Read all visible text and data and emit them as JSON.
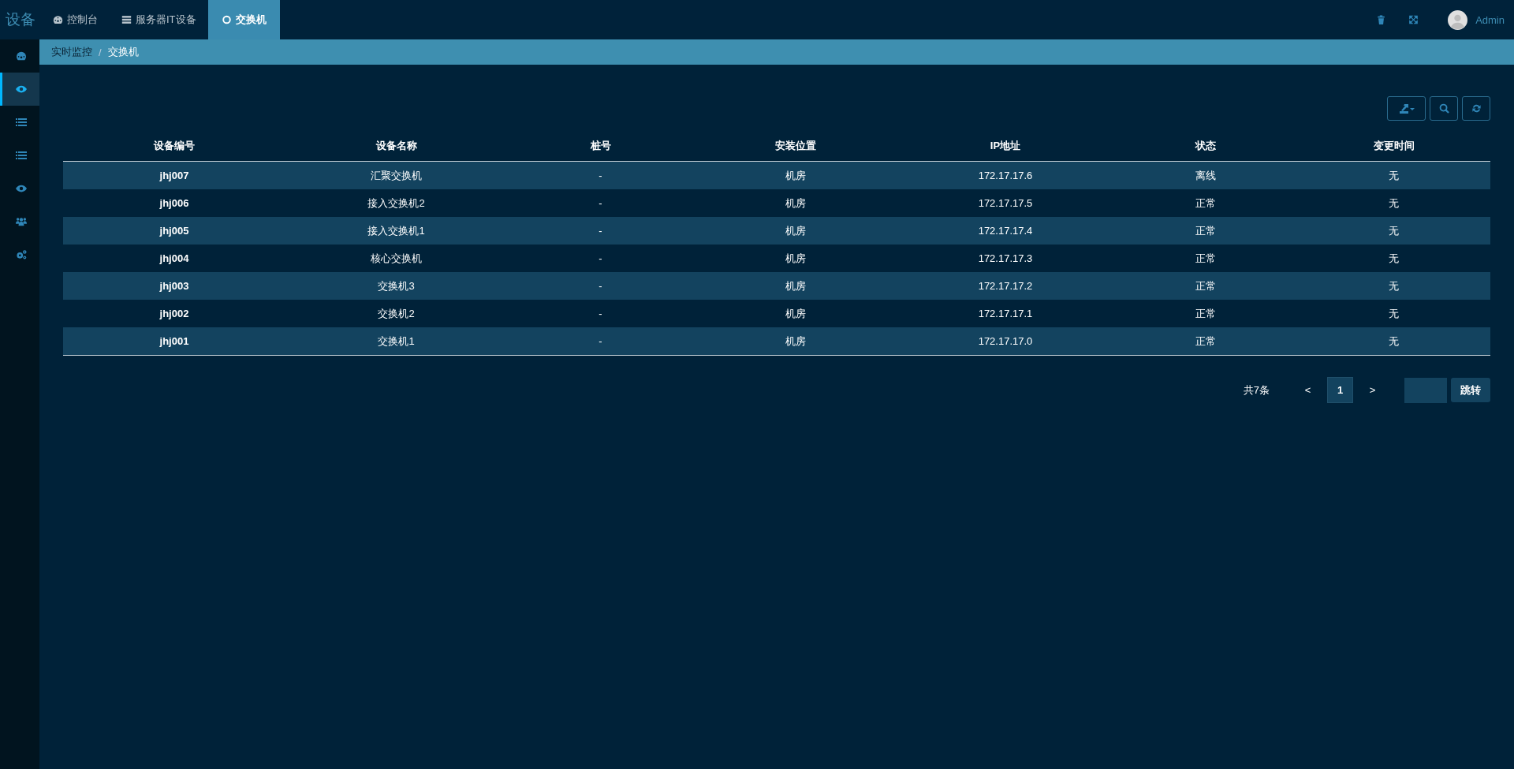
{
  "header": {
    "brand": "设备",
    "user": "Admin"
  },
  "tabs": [
    {
      "label": "控制台",
      "kind": "gauge",
      "selected": false
    },
    {
      "label": "服务器IT设备",
      "kind": "server",
      "selected": false
    },
    {
      "label": "交换机",
      "kind": "circle",
      "selected": true
    }
  ],
  "sidebar": {
    "items": [
      {
        "kind": "gauge",
        "selected": false
      },
      {
        "kind": "eye",
        "selected": true
      },
      {
        "kind": "list",
        "selected": false
      },
      {
        "kind": "list",
        "selected": false
      },
      {
        "kind": "eye",
        "selected": false
      },
      {
        "kind": "users",
        "selected": false
      },
      {
        "kind": "gears",
        "selected": false
      }
    ]
  },
  "breadcrumb": {
    "items": [
      "实时监控",
      "交换机"
    ],
    "separator": "/"
  },
  "table": {
    "columns": [
      "设备编号",
      "设备名称",
      "桩号",
      "安装位置",
      "IP地址",
      "状态",
      "变更时间"
    ],
    "rows": [
      [
        "jhj007",
        "汇聚交换机",
        "-",
        "机房",
        "172.17.17.6",
        "离线",
        "无"
      ],
      [
        "jhj006",
        "接入交换机2",
        "-",
        "机房",
        "172.17.17.5",
        "正常",
        "无"
      ],
      [
        "jhj005",
        "接入交换机1",
        "-",
        "机房",
        "172.17.17.4",
        "正常",
        "无"
      ],
      [
        "jhj004",
        "核心交换机",
        "-",
        "机房",
        "172.17.17.3",
        "正常",
        "无"
      ],
      [
        "jhj003",
        "交换机3",
        "-",
        "机房",
        "172.17.17.2",
        "正常",
        "无"
      ],
      [
        "jhj002",
        "交换机2",
        "-",
        "机房",
        "172.17.17.1",
        "正常",
        "无"
      ],
      [
        "jhj001",
        "交换机1",
        "-",
        "机房",
        "172.17.17.0",
        "正常",
        "无"
      ]
    ]
  },
  "pagination": {
    "total": "共7条",
    "prev": "<",
    "pages": [
      {
        "label": "1",
        "selected": true
      }
    ],
    "next": ">",
    "jump_button": "跳转"
  }
}
